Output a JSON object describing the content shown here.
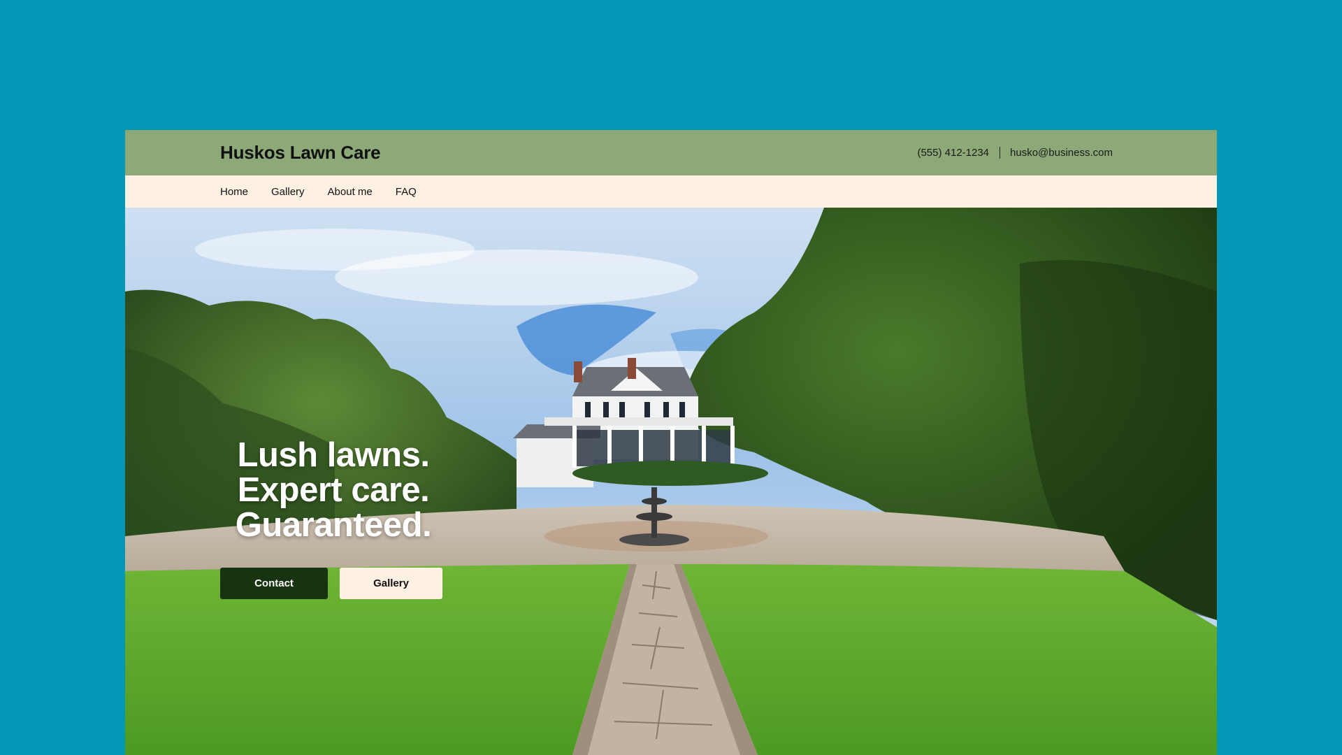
{
  "site": {
    "brand": "Huskos Lawn Care",
    "phone": "(555) 412-1234",
    "email": "husko@business.com",
    "colors": {
      "background": "#0197b5",
      "topbar": "#8da977",
      "navbar": "#fff0e4",
      "primary_button": "#17330f"
    }
  },
  "nav": {
    "items": [
      {
        "label": "Home"
      },
      {
        "label": "Gallery"
      },
      {
        "label": "About me"
      },
      {
        "label": "FAQ"
      }
    ]
  },
  "hero": {
    "headline_lines": [
      "Lush lawns.",
      "Expert care.",
      "Guaranteed."
    ],
    "primary_button": "Contact",
    "secondary_button": "Gallery"
  }
}
